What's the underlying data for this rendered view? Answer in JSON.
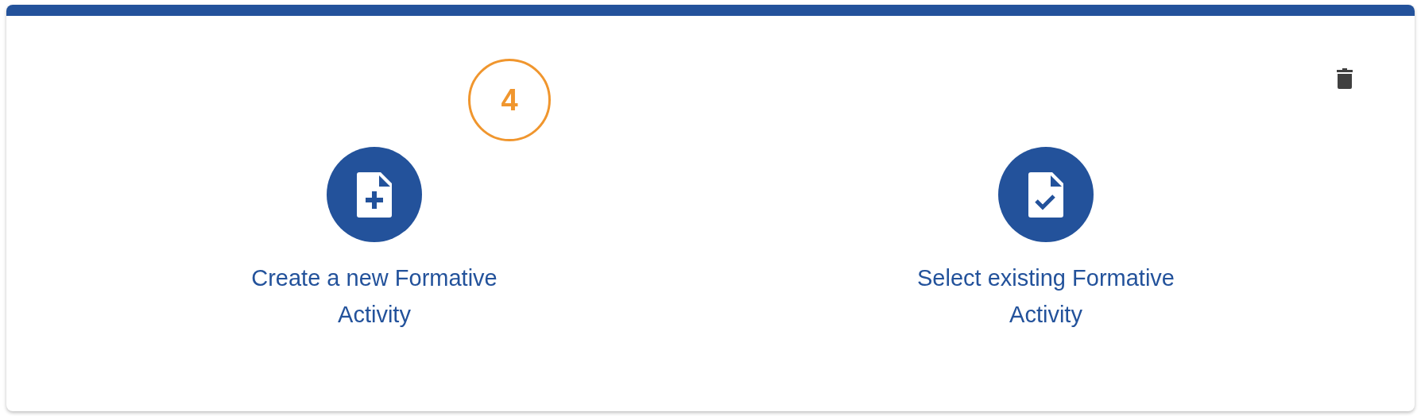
{
  "step_badge": "4",
  "options": [
    {
      "kind": "create",
      "label": "Create a new Formative Activity"
    },
    {
      "kind": "select",
      "label": "Select existing Formative Activity"
    }
  ]
}
